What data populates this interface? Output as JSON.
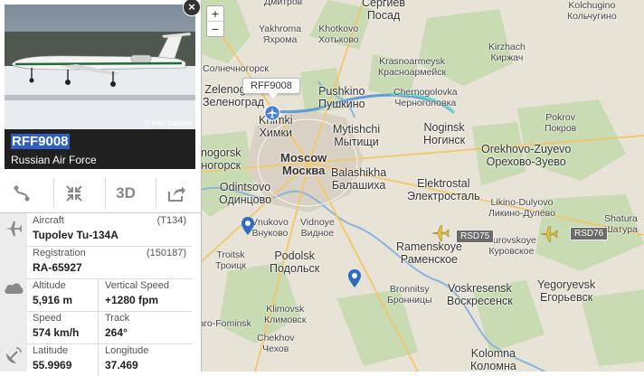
{
  "map": {
    "zoom_in": "+",
    "zoom_out": "−",
    "cities": [
      {
        "id": "dmitrov",
        "en": "Дмитров",
        "ru": ""
      },
      {
        "id": "sergiev",
        "en": "Сергиев",
        "ru": "Посад"
      },
      {
        "id": "kolchugino",
        "en": "Kolchugino",
        "ru": "Кольчугино"
      },
      {
        "id": "yakhroma",
        "en": "Yakhroma",
        "ru": "Яхрома"
      },
      {
        "id": "khotkovo",
        "en": "Khotkovo",
        "ru": "Хотьково"
      },
      {
        "id": "krasnoarmeysk",
        "en": "Krasnoarmeysk",
        "ru": "Красноармейск"
      },
      {
        "id": "kirzhach",
        "en": "Kirzhach",
        "ru": "Киржач"
      },
      {
        "id": "solnechnogorsk",
        "en": "Солнечногорск",
        "ru": ""
      },
      {
        "id": "zelenograd",
        "en": "Zelenograd",
        "ru": "Зеленоград"
      },
      {
        "id": "pushkino",
        "en": "Pushkino",
        "ru": "Пушкино"
      },
      {
        "id": "chernogolovka",
        "en": "Chernogolovka",
        "ru": "Черноголовка"
      },
      {
        "id": "pokrov",
        "en": "Pokrov",
        "ru": "Покров"
      },
      {
        "id": "khimki",
        "en": "Khimki",
        "ru": "Химки"
      },
      {
        "id": "mytishchi",
        "en": "Mytishchi",
        "ru": "Мытищи"
      },
      {
        "id": "noginsk",
        "en": "Noginsk",
        "ru": "Ногинск"
      },
      {
        "id": "orekhovo",
        "en": "Orekhovo-Zuyevo",
        "ru": "Орехово-Зуево"
      },
      {
        "id": "krasnogorsk",
        "en": "nogorsk",
        "ru": "ногорск"
      },
      {
        "id": "moscow",
        "en": "Moscow",
        "ru": "Москва"
      },
      {
        "id": "balashikha",
        "en": "Balashikha",
        "ru": "Балашиха"
      },
      {
        "id": "elektrostal",
        "en": "Elektrostal",
        "ru": "Электросталь"
      },
      {
        "id": "odintsovo",
        "en": "Odintsovo",
        "ru": "Одинцово"
      },
      {
        "id": "likino",
        "en": "Likino-Dulyovo",
        "ru": "Ликино-Дулёво"
      },
      {
        "id": "vnukovo",
        "en": "Vnukovo",
        "ru": "Внуково"
      },
      {
        "id": "vidnoye",
        "en": "Vidnoye",
        "ru": "Видное"
      },
      {
        "id": "shatura",
        "en": "Shatura",
        "ru": "Шатура"
      },
      {
        "id": "troitsk",
        "en": "Troitsk",
        "ru": "Троицк"
      },
      {
        "id": "podolsk",
        "en": "Podolsk",
        "ru": "Подольск"
      },
      {
        "id": "ramenskoye",
        "en": "Ramenskoye",
        "ru": "Раменское"
      },
      {
        "id": "kurovskoye",
        "en": "Kurovskoye",
        "ru": "Куровское"
      },
      {
        "id": "bronnitsy",
        "en": "Bronnitsy",
        "ru": "Бронницы"
      },
      {
        "id": "voskresensk",
        "en": "Voskresensk",
        "ru": "Воскресенск"
      },
      {
        "id": "yegoryevsk",
        "en": "Yegoryevsk",
        "ru": "Егорьевск"
      },
      {
        "id": "klimovsk",
        "en": "Klimovsk",
        "ru": "Климовск"
      },
      {
        "id": "chekhov",
        "en": "Chekhov",
        "ru": "Чехов"
      },
      {
        "id": "kolomna",
        "en": "Kolomna",
        "ru": "Коломна"
      },
      {
        "id": "naro",
        "en": "Naro-Fominsk",
        "ru": ""
      }
    ],
    "selected_callout": "RFF9008",
    "other_flights": [
      "RSD75",
      "RSD76"
    ]
  },
  "panel": {
    "close": "×",
    "photo_credit": "© Ivan Savickii",
    "callsign": "RFF9008",
    "airline": "Russian Air Force",
    "toolbar": {
      "route_icon": "route-icon",
      "fit_icon": "fit-icon",
      "view3d": "3D",
      "share_icon": "share-icon"
    },
    "aircraft": {
      "label": "Aircraft",
      "value": "Tupolev Tu-134A",
      "code": "(T134)"
    },
    "registration": {
      "label": "Registration",
      "value": "RA-65927",
      "code": "(150187)"
    },
    "altitude": {
      "label": "Altitude",
      "value": "5,916 m"
    },
    "vspeed": {
      "label": "Vertical Speed",
      "value": "+1280 fpm"
    },
    "speed": {
      "label": "Speed",
      "value": "574 km/h"
    },
    "track": {
      "label": "Track",
      "value": "264°"
    },
    "latitude": {
      "label": "Latitude",
      "value": "55.9969"
    },
    "longitude": {
      "label": "Longitude",
      "value": "37.469"
    }
  },
  "colors": {
    "accent": "#2d5fc4",
    "track": "#4a90d9",
    "plane": "#e8c83a"
  }
}
